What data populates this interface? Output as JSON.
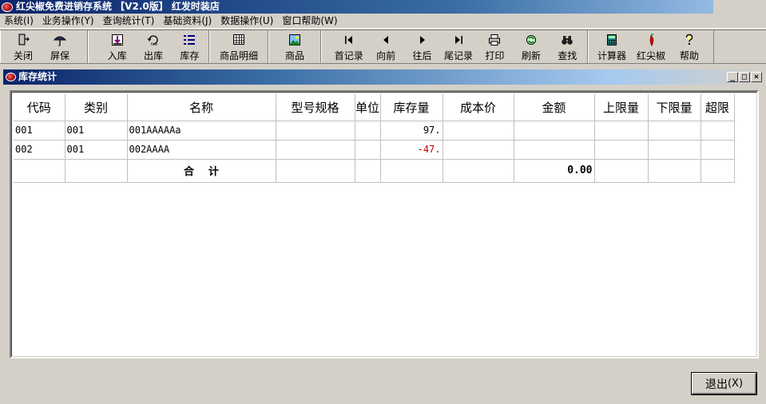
{
  "window": {
    "title": "红尖椒免费进销存系统 【V2.0版】 红发时装店"
  },
  "menu": [
    {
      "label": "系统(I)"
    },
    {
      "label": "业务操作(Y)"
    },
    {
      "label": "查询统计(T)"
    },
    {
      "label": "基础资料(J)"
    },
    {
      "label": "数据操作(U)"
    },
    {
      "label": "窗口帮助(W)"
    }
  ],
  "toolbar": {
    "groups": [
      [
        {
          "label": "关闭",
          "icon": "door-exit-icon"
        },
        {
          "label": "屏保",
          "icon": "umbrella-icon"
        }
      ],
      [
        {
          "label": "入库",
          "icon": "stock-in-icon"
        },
        {
          "label": "出库",
          "icon": "stock-out-icon"
        },
        {
          "label": "库存",
          "icon": "inventory-list-icon"
        }
      ],
      [
        {
          "label": "商品明细",
          "icon": "table-grid-icon"
        }
      ],
      [
        {
          "label": "商品",
          "icon": "picture-icon"
        }
      ],
      [
        {
          "label": "首记录",
          "icon": "first-record-icon"
        },
        {
          "label": "向前",
          "icon": "previous-icon"
        },
        {
          "label": "往后",
          "icon": "next-icon"
        },
        {
          "label": "尾记录",
          "icon": "last-record-icon"
        },
        {
          "label": "打印",
          "icon": "printer-icon"
        },
        {
          "label": "刷新",
          "icon": "refresh-icon"
        },
        {
          "label": "查找",
          "icon": "binoculars-icon"
        }
      ],
      [
        {
          "label": "计算器",
          "icon": "calculator-icon"
        },
        {
          "label": "红尖椒",
          "icon": "chili-pepper-icon"
        },
        {
          "label": "帮助",
          "icon": "help-icon"
        }
      ]
    ]
  },
  "child_window": {
    "title": "库存统计",
    "buttons": {
      "minimize": "_",
      "restore": "□",
      "close": "×"
    }
  },
  "grid": {
    "columns": [
      "代码",
      "类别",
      "名称",
      "型号规格",
      "单位",
      "库存量",
      "成本价",
      "金额",
      "上限量",
      "下限量",
      "超限"
    ],
    "rows": [
      {
        "code": "001",
        "category": "001",
        "name": "001AAAAAa",
        "spec": "",
        "unit": "",
        "qty": "97.",
        "cost": "",
        "amount": "",
        "upper": "",
        "lower": "",
        "over": ""
      },
      {
        "code": "002",
        "category": "001",
        "name": "002AAAA",
        "spec": "",
        "unit": "",
        "qty": "-47.",
        "cost": "",
        "amount": "",
        "upper": "",
        "lower": "",
        "over": ""
      }
    ],
    "total": {
      "label": "合    计",
      "amount": "0.00"
    }
  },
  "exit_button": {
    "label": "退出",
    "shortcut": "(X)"
  },
  "colors": {
    "negative": "#c00000",
    "title_bar": "#0a246a"
  }
}
